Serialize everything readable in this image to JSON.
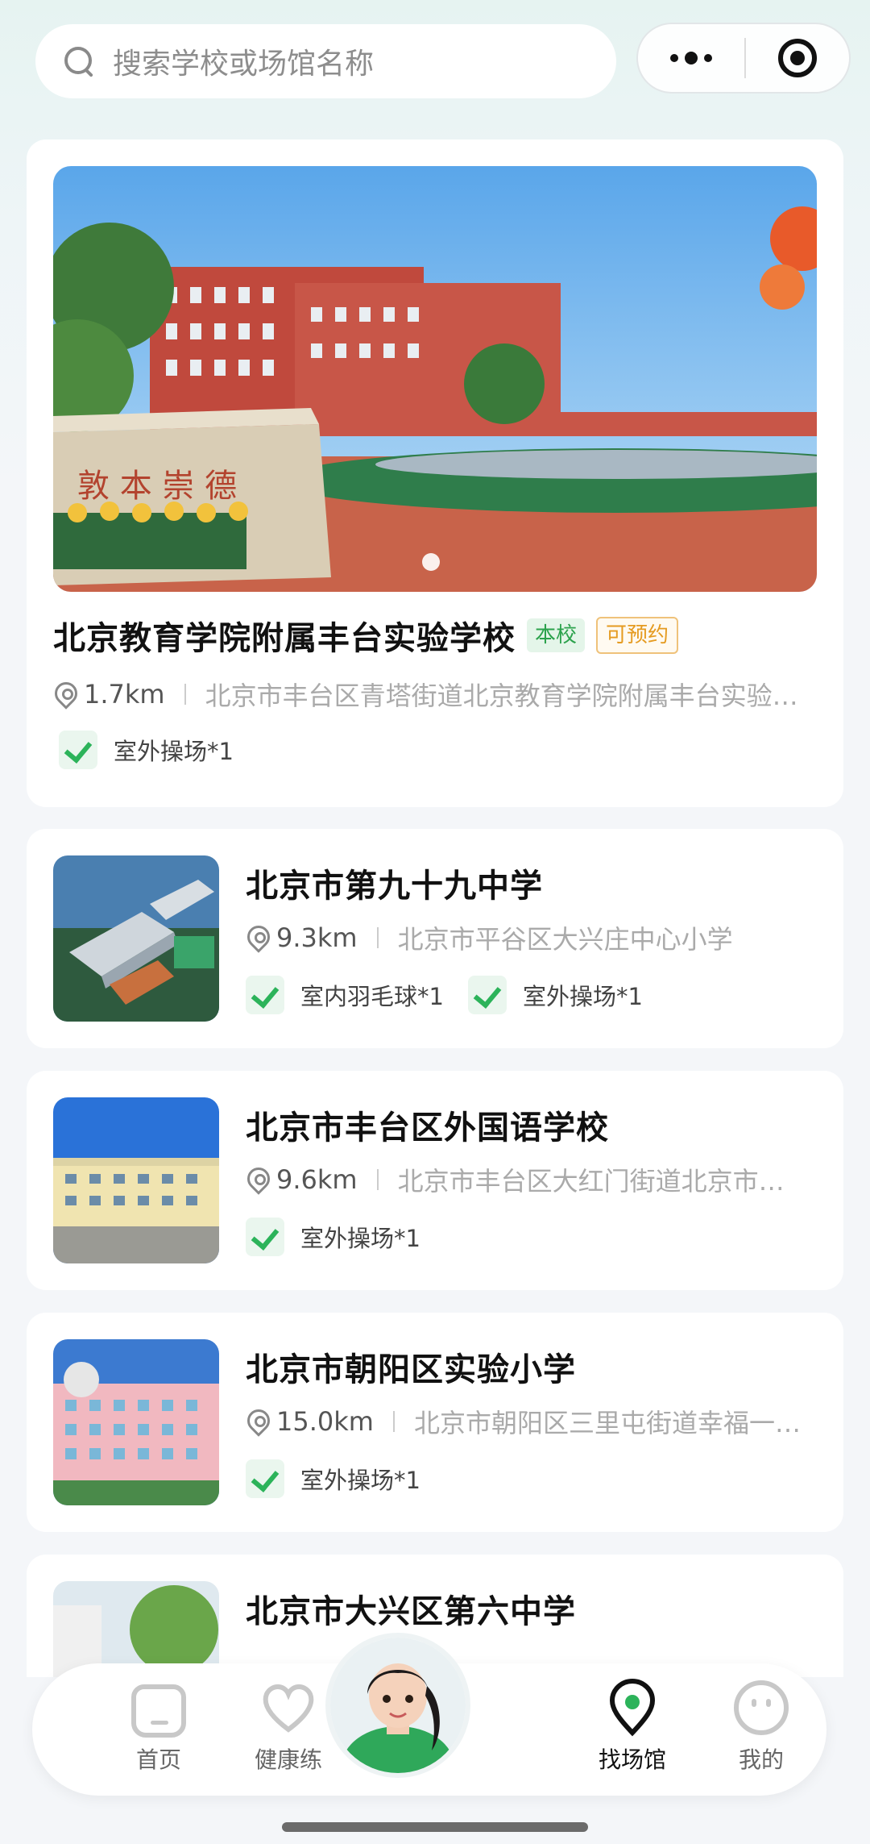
{
  "search": {
    "placeholder": "搜索学校或场馆名称"
  },
  "featured": {
    "name": "北京教育学院附属丰台实验学校",
    "tag_school": "本校",
    "tag_bookable": "可预约",
    "distance": "1.7km",
    "address": "北京市丰台区青塔街道北京教育学院附属丰台实验…",
    "facilities": [
      "室外操场*1"
    ]
  },
  "venues": [
    {
      "name": "北京市第九十九中学",
      "distance": "9.3km",
      "address": "北京市平谷区大兴庄中心小学",
      "facilities": [
        "室内羽毛球*1",
        "室外操场*1"
      ]
    },
    {
      "name": "北京市丰台区外国语学校",
      "distance": "9.6km",
      "address": "北京市丰台区大红门街道北京市…",
      "facilities": [
        "室外操场*1"
      ]
    },
    {
      "name": "北京市朝阳区实验小学",
      "distance": "15.0km",
      "address": "北京市朝阳区三里屯街道幸福一…",
      "facilities": [
        "室外操场*1"
      ]
    },
    {
      "name": "北京市大兴区第六中学",
      "distance": "",
      "address": "",
      "facilities": []
    }
  ],
  "nav": {
    "home": "首页",
    "health": "健康练",
    "venue": "找场馆",
    "mine": "我的"
  },
  "colors": {
    "accent": "#2cb35a",
    "tag_orange": "#e59b21"
  }
}
